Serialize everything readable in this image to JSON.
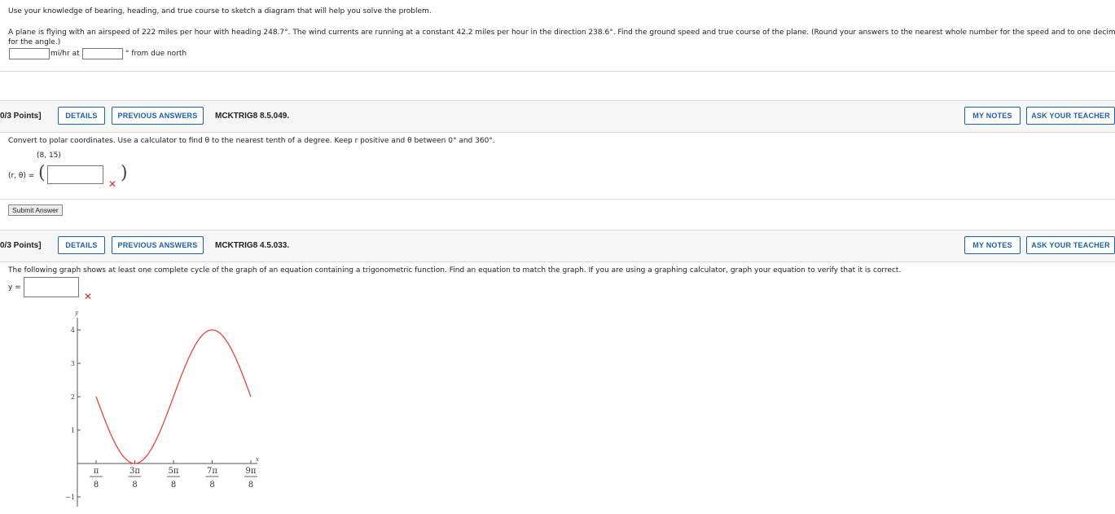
{
  "problem1": {
    "instruction": "Use your knowledge of bearing, heading, and true course to sketch a diagram that will help you solve the problem.",
    "text_line1": "A plane is flying with an airspeed of 222 miles per hour with heading 248.7°. The wind currents are running at a constant 42.2 miles per hour in the direction 238.6°. Find the ground speed and true course of the plane. (Round your answers to the nearest whole number for the speed and to one decimal place",
    "text_line2": "for the angle.)",
    "unit_speed": "mi/hr at",
    "unit_angle": "° from due north",
    "speed_value": "",
    "angle_value": ""
  },
  "problem2": {
    "points": "0/3 Points]",
    "details_label": "DETAILS",
    "previous_label": "PREVIOUS ANSWERS",
    "question_id": "MCKTRIG8 8.5.049.",
    "my_notes_label": "MY NOTES",
    "ask_teacher_label": "ASK YOUR TEACHER",
    "prompt": "Convert to polar coordinates. Use a calculator to find θ to the nearest tenth of a degree. Keep r positive and θ between 0° and 360°.",
    "point": "(8, 15)",
    "answer_label": "(r, θ) =",
    "answer_value": "",
    "submit_label": "Submit Answer"
  },
  "problem3": {
    "points": "0/3 Points]",
    "details_label": "DETAILS",
    "previous_label": "PREVIOUS ANSWERS",
    "question_id": "MCKTRIG8 4.5.033.",
    "my_notes_label": "MY NOTES",
    "ask_teacher_label": "ASK YOUR TEACHER",
    "prompt": "The following graph shows at least one complete cycle of the graph of an equation containing a trigonometric function. Find an equation to match the graph. If you are using a graphing calculator, graph your equation to verify that it is correct.",
    "answer_label": "y =",
    "answer_value": ""
  },
  "colors": {
    "accent": "#1d5fa8",
    "wrong": "#e0262f",
    "curve": "#e8372f"
  },
  "chart_data": {
    "type": "line",
    "xlabel": "x",
    "ylabel": "y",
    "x_ticks": [
      {
        "num": "π",
        "den": "8",
        "value": 0.3927
      },
      {
        "num": "3π",
        "den": "8",
        "value": 1.1781
      },
      {
        "num": "5π",
        "den": "8",
        "value": 1.9635
      },
      {
        "num": "7π",
        "den": "8",
        "value": 2.7489
      },
      {
        "num": "9π",
        "den": "8",
        "value": 3.5343
      }
    ],
    "y_ticks": [
      -1,
      1,
      2,
      3,
      4
    ],
    "ylim": [
      -1,
      4
    ],
    "series": [
      {
        "points": [
          [
            0.3927,
            2
          ],
          [
            1.1781,
            0
          ],
          [
            1.9635,
            2
          ],
          [
            2.7489,
            4
          ],
          [
            3.5343,
            2
          ]
        ]
      }
    ]
  }
}
